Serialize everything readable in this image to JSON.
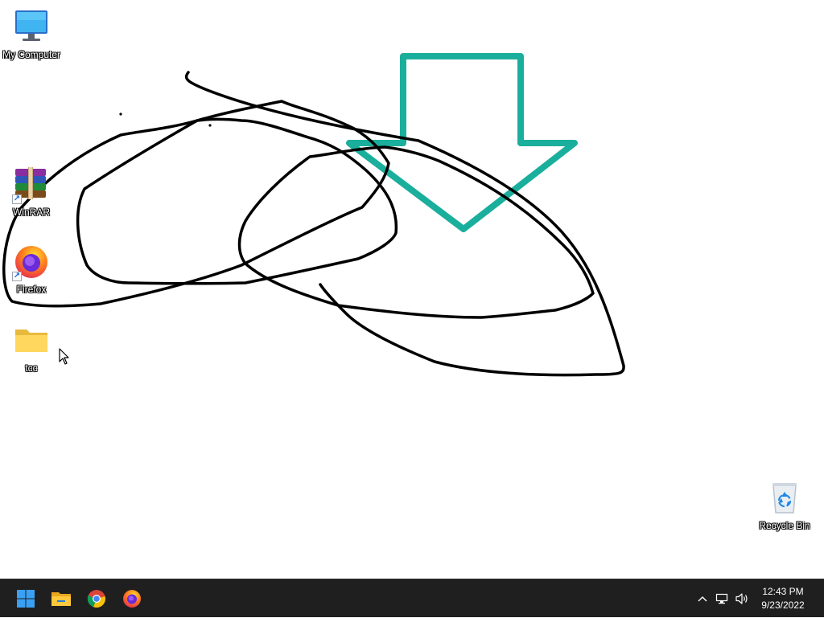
{
  "desktop": {
    "icons": [
      {
        "label": "My Computer",
        "icon": "monitor-icon"
      },
      {
        "label": "WinRAR",
        "icon": "winrar-books-icon"
      },
      {
        "label": "Firefox",
        "icon": "firefox-icon"
      },
      {
        "label": "tcc",
        "icon": "folder-icon"
      },
      {
        "label": "Recycle Bin",
        "icon": "recycle-bin-icon"
      }
    ],
    "annotation_colors": {
      "scribble": "#000000",
      "arrow": "#1aaf9c"
    }
  },
  "taskbar": {
    "pinned": [
      {
        "name": "Start",
        "icon": "windows-start-icon"
      },
      {
        "name": "File Explorer",
        "icon": "file-explorer-icon"
      },
      {
        "name": "Google Chrome",
        "icon": "chrome-icon"
      },
      {
        "name": "Firefox",
        "icon": "firefox-icon"
      }
    ],
    "tray": {
      "icons": [
        "chevron-up-icon",
        "network-icon",
        "speaker-icon"
      ]
    },
    "clock": {
      "time": "12:43 PM",
      "date": "9/23/2022"
    },
    "background": "#1f1f1f"
  }
}
